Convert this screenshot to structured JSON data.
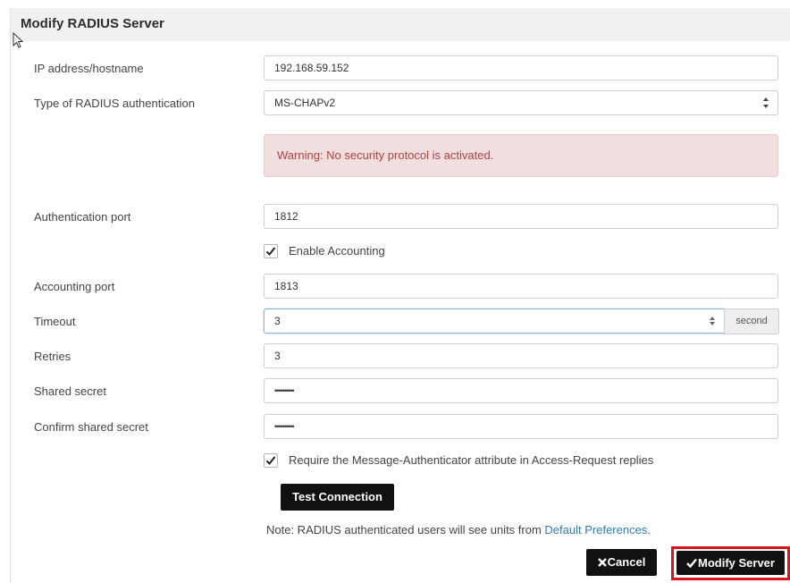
{
  "dialog": {
    "title": "Modify RADIUS Server"
  },
  "fields": {
    "ip_label": "IP address/hostname",
    "ip_value": "192.168.59.152",
    "auth_type_label": "Type of RADIUS authentication",
    "auth_type_value": "MS-CHAPv2",
    "warning": "Warning: No security protocol is activated.",
    "auth_port_label": "Authentication port",
    "auth_port_value": "1812",
    "enable_accounting_label": "Enable Accounting",
    "enable_accounting_checked": true,
    "acct_port_label": "Accounting port",
    "acct_port_value": "1813",
    "timeout_label": "Timeout",
    "timeout_value": "3",
    "timeout_unit": "second",
    "retries_label": "Retries",
    "retries_value": "3",
    "secret_label": "Shared secret",
    "secret_value": "••••••••••",
    "confirm_secret_label": "Confirm shared secret",
    "confirm_secret_value": "••••••••••",
    "message_auth_label": "Require the Message-Authenticator attribute in Access-Request replies",
    "message_auth_checked": true
  },
  "buttons": {
    "test_connection": "Test Connection",
    "cancel": "Cancel",
    "modify": "Modify Server"
  },
  "note": {
    "text": "Note: RADIUS authenticated users will see units from ",
    "link": "Default Preferences",
    "suffix": "."
  },
  "colors": {
    "warning_bg": "#f2dede",
    "warning_text": "#a94442",
    "link": "#2f7bb6",
    "highlight_outline": "#d9141c",
    "button_bg": "#111111"
  }
}
